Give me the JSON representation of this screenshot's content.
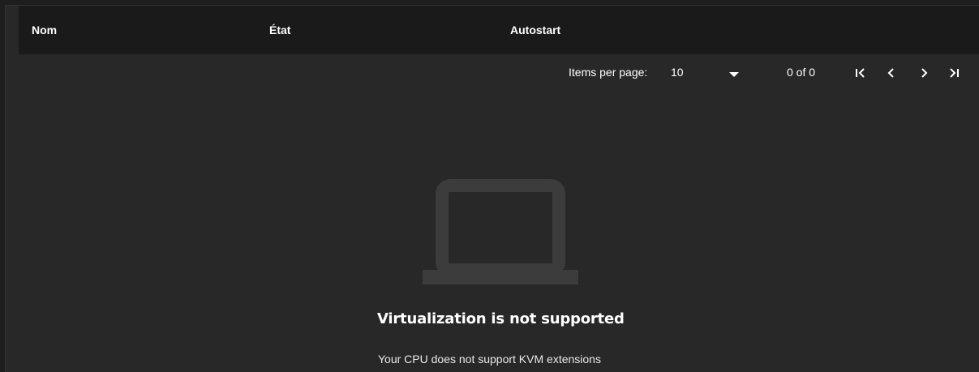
{
  "table": {
    "columns": [
      "Nom",
      "État",
      "Autostart"
    ]
  },
  "paginator": {
    "items_per_page_label": "Items per page:",
    "page_size": "10",
    "range_label": "0 of 0"
  },
  "empty_state": {
    "icon": "laptop-icon",
    "title": "Virtualization is not supported",
    "message": "Your CPU does not support KVM extensions"
  },
  "colors": {
    "background": "#1e1e1e",
    "card": "#282828",
    "header": "#1a1a1a",
    "icon": "#3c3c3c"
  }
}
